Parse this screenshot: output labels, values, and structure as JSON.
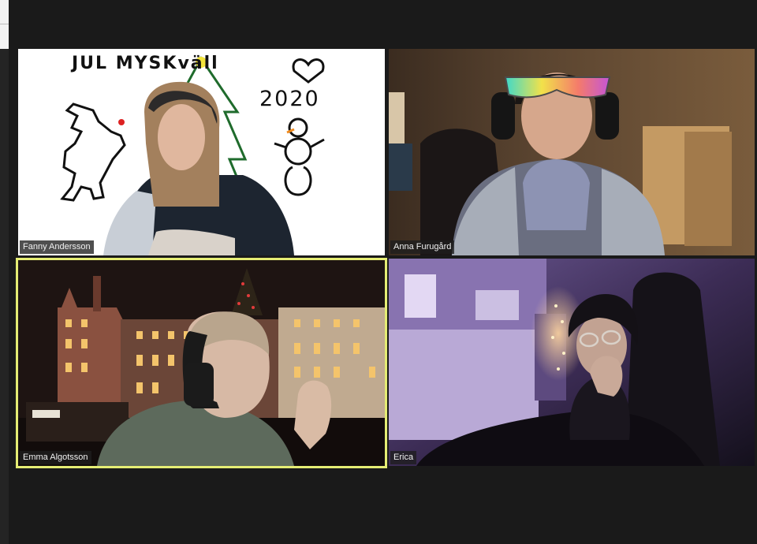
{
  "gallery": {
    "participants": [
      {
        "name": "Fanny Andersson",
        "active_speaker": false
      },
      {
        "name": "Anna Furugård",
        "active_speaker": false
      },
      {
        "name": "Emma Algotsson",
        "active_speaker": true
      },
      {
        "name": "Erica",
        "active_speaker": false
      }
    ],
    "doodle": {
      "title": "JUL MYSKväll",
      "year": "2020"
    }
  },
  "colors": {
    "background": "#1a1a1a",
    "active_speaker_border": "#e5ed74",
    "name_label_bg": "#1e1e1e"
  }
}
